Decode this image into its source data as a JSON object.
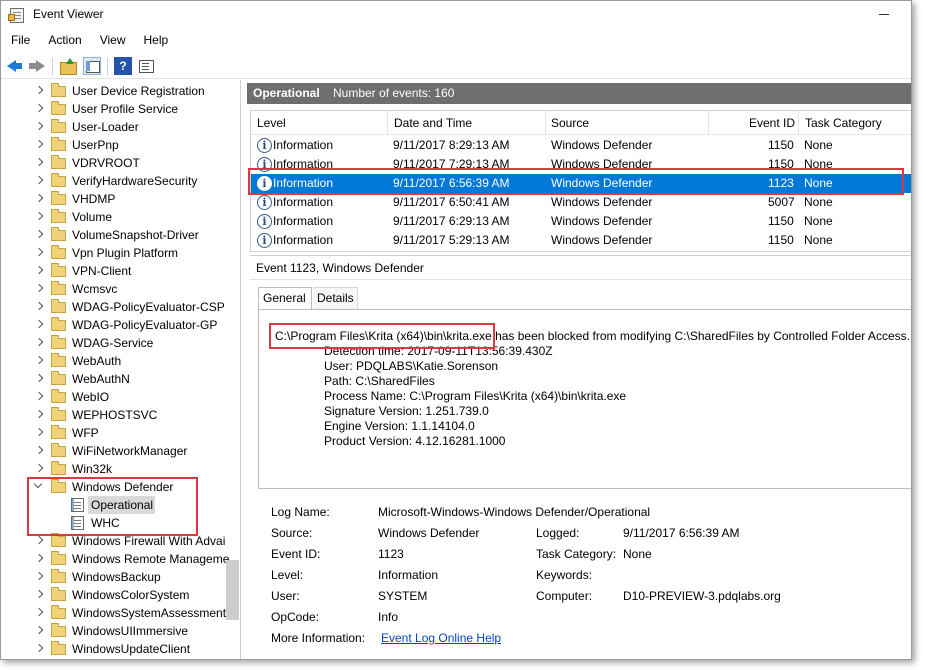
{
  "window": {
    "title": "Event Viewer"
  },
  "menu": [
    "File",
    "Action",
    "View",
    "Help"
  ],
  "toolbar": {
    "back": "back-arrow-icon",
    "forward": "forward-arrow-icon",
    "up": "folder-up-icon",
    "show_hide": "show-hide-console-tree-icon",
    "help": "?",
    "properties": "properties-icon"
  },
  "tree": {
    "folders": [
      "User Device Registration",
      "User Profile Service",
      "User-Loader",
      "UserPnp",
      "VDRVROOT",
      "VerifyHardwareSecurity",
      "VHDMP",
      "Volume",
      "VolumeSnapshot-Driver",
      "Vpn Plugin Platform",
      "VPN-Client",
      "Wcmsvc",
      "WDAG-PolicyEvaluator-CSP",
      "WDAG-PolicyEvaluator-GP",
      "WDAG-Service",
      "WebAuth",
      "WebAuthN",
      "WebIO",
      "WEPHOSTSVC",
      "WFP",
      "WiFiNetworkManager",
      "Win32k"
    ],
    "expanded_folder": "Windows Defender",
    "expanded_children": [
      "Operational",
      "WHC"
    ],
    "more_folders": [
      "Windows Firewall With Advai",
      "Windows Remote Manageme",
      "WindowsBackup",
      "WindowsColorSystem",
      "WindowsSystemAssessment",
      "WindowsUIImmersive",
      "WindowsUpdateClient"
    ]
  },
  "log_header": {
    "title": "Operational",
    "count": "Number of events: 160"
  },
  "columns": [
    "Level",
    "Date and Time",
    "Source",
    "Event ID",
    "Task Category"
  ],
  "events": [
    {
      "level": "Information",
      "date": "9/11/2017 8:29:13 AM",
      "source": "Windows Defender",
      "id": "1150",
      "task": "None"
    },
    {
      "level": "Information",
      "date": "9/11/2017 7:29:13 AM",
      "source": "Windows Defender",
      "id": "1150",
      "task": "None"
    },
    {
      "level": "Information",
      "date": "9/11/2017 6:56:39 AM",
      "source": "Windows Defender",
      "id": "1123",
      "task": "None"
    },
    {
      "level": "Information",
      "date": "9/11/2017 6:50:41 AM",
      "source": "Windows Defender",
      "id": "5007",
      "task": "None"
    },
    {
      "level": "Information",
      "date": "9/11/2017 6:29:13 AM",
      "source": "Windows Defender",
      "id": "1150",
      "task": "None"
    },
    {
      "level": "Information",
      "date": "9/11/2017 5:29:13 AM",
      "source": "Windows Defender",
      "id": "1150",
      "task": "None"
    }
  ],
  "detail": {
    "title": "Event 1123, Windows Defender",
    "tabs": [
      "General",
      "Details"
    ],
    "desc_path": "C:\\Program Files\\Krita (x64)\\bin\\krita.exe",
    "desc_rest": "has been blocked from modifying C:\\SharedFiles by Controlled Folder Access.",
    "desc_lines": [
      "Detection time: 2017-09-11T13:56:39.430Z",
      "User: PDQLABS\\Katie.Sorenson",
      "Path: C:\\SharedFiles",
      "Process Name: C:\\Program Files\\Krita (x64)\\bin\\krita.exe",
      "Signature Version: 1.251.739.0",
      "Engine Version: 1.1.14104.0",
      "Product Version: 4.12.16281.1000"
    ],
    "log_name_label": "Log Name:",
    "log_name": "Microsoft-Windows-Windows Defender/Operational",
    "source_label": "Source:",
    "source": "Windows Defender",
    "logged_label": "Logged:",
    "logged": "9/11/2017 6:56:39 AM",
    "event_id_label": "Event ID:",
    "event_id": "1123",
    "task_label": "Task Category:",
    "task": "None",
    "level_label": "Level:",
    "level": "Information",
    "keywords_label": "Keywords:",
    "keywords": "",
    "user_label": "User:",
    "user": "SYSTEM",
    "computer_label": "Computer:",
    "computer": "D10-PREVIEW-3.pdqlabs.org",
    "opcode_label": "OpCode:",
    "opcode": "Info",
    "more_info_label": "More Information:",
    "more_info_link": "Event Log Online Help"
  },
  "colors": {
    "selection": "#0078d7",
    "header_bar": "#6e6e6e",
    "highlight": "#d9393f",
    "link": "#0645c2"
  }
}
